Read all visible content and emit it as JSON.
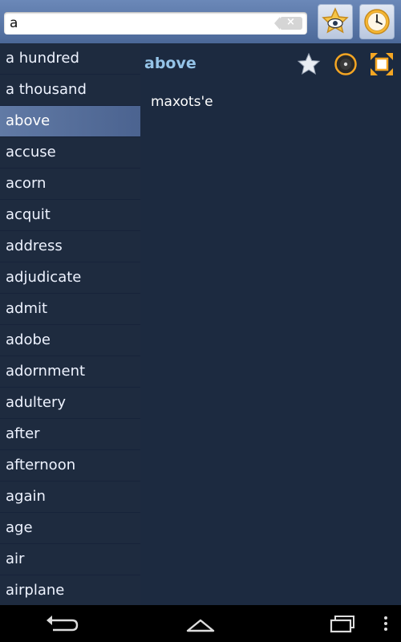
{
  "search": {
    "value": "a"
  },
  "toolbar": {
    "favorites_icon": "eye-star-icon",
    "history_icon": "clock-icon"
  },
  "list": {
    "items": [
      {
        "label": "a hundred"
      },
      {
        "label": "a thousand"
      },
      {
        "label": "above",
        "selected": true
      },
      {
        "label": "accuse"
      },
      {
        "label": "acorn"
      },
      {
        "label": "acquit"
      },
      {
        "label": "address"
      },
      {
        "label": "adjudicate"
      },
      {
        "label": "admit"
      },
      {
        "label": "adobe"
      },
      {
        "label": "adornment"
      },
      {
        "label": "adultery"
      },
      {
        "label": "after"
      },
      {
        "label": "afternoon"
      },
      {
        "label": "again"
      },
      {
        "label": "age"
      },
      {
        "label": "air"
      },
      {
        "label": "airplane"
      }
    ]
  },
  "detail": {
    "word": "above",
    "translation": "maxots'e",
    "icons": [
      "star-icon",
      "audio-icon",
      "expand-icon"
    ]
  },
  "colors": {
    "topbar": "#5a78a8",
    "background": "#1e2b3f",
    "selected": "#5670a0",
    "word": "#95c4e8",
    "navbar": "#000000"
  }
}
